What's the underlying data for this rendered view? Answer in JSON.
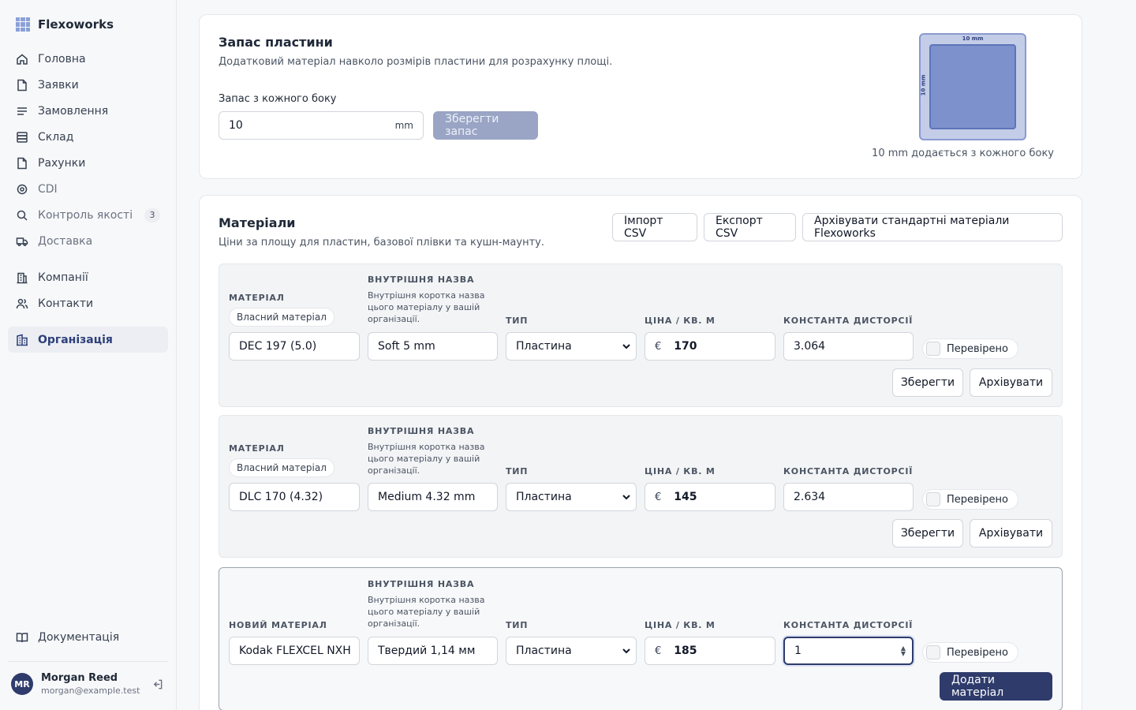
{
  "app": {
    "name": "Flexoworks"
  },
  "sidebar": {
    "items": [
      {
        "label": "Головна",
        "icon": "home-icon"
      },
      {
        "label": "Заявки",
        "icon": "file-icon"
      },
      {
        "label": "Замовлення",
        "icon": "list-icon"
      },
      {
        "label": "Склад",
        "icon": "database-icon"
      },
      {
        "label": "Рахунки",
        "icon": "file-icon"
      },
      {
        "label": "CDI",
        "icon": "target-icon"
      },
      {
        "label": "Контроль якості",
        "icon": "search-icon",
        "badge": "3"
      },
      {
        "label": "Доставка",
        "icon": "truck-icon"
      }
    ],
    "items2": [
      {
        "label": "Компанії",
        "icon": "building-icon"
      },
      {
        "label": "Контакти",
        "icon": "users-icon"
      }
    ],
    "active": {
      "label": "Організація",
      "icon": "organization-icon"
    },
    "docs": "Документація",
    "user": {
      "initials": "MR",
      "name": "Morgan Reed",
      "email": "morgan@example.test"
    }
  },
  "margin": {
    "title": "Запас пластини",
    "subtitle": "Додатковий матеріал навколо розмірів пластини для розрахунку площі.",
    "field_label": "Запас з кожного боку",
    "value": "10",
    "unit": "mm",
    "save": "Зберегти запас",
    "preview_top": "10 mm",
    "preview_side": "10 mm",
    "preview_caption": "10 mm додається з кожного боку"
  },
  "materials": {
    "title": "Матеріали",
    "subtitle": "Ціни за площу для пластин, базової плівки та кушн-маунту.",
    "import": "Імпорт CSV",
    "export": "Експорт CSV",
    "archive_std": "Архівувати стандартні матеріали Flexoworks",
    "col_material": "МАТЕРІАЛ",
    "col_new_material": "НОВИЙ МАТЕРІАЛ",
    "col_internal": "ВНУТРІШНЯ НАЗВА",
    "internal_help": "Внутрішня коротка назва цього матеріалу у вашій організації.",
    "col_type": "ТИП",
    "col_price": "ЦІНА / КВ. М",
    "col_distortion": "КОНСТАНТА ДИСТОРСІЇ",
    "own_badge": "Власний матеріал",
    "currency": "€",
    "verified": "Перевірено",
    "save": "Зберегти",
    "archive": "Архівувати",
    "add": "Додати матеріал",
    "rows": [
      {
        "material": "DEC 197 (5.0)",
        "internal": "Soft 5 mm",
        "type": "Пластина",
        "price": "170",
        "distortion": "3.064"
      },
      {
        "material": "DLC 170 (4.32)",
        "internal": "Medium 4.32 mm",
        "type": "Пластина",
        "price": "145",
        "distortion": "2.634"
      }
    ],
    "new_row": {
      "material": "Kodak FLEXCEL NXH",
      "internal": "Твердий 1,14 мм",
      "type": "Пластина",
      "price": "185",
      "distortion": "1"
    }
  }
}
